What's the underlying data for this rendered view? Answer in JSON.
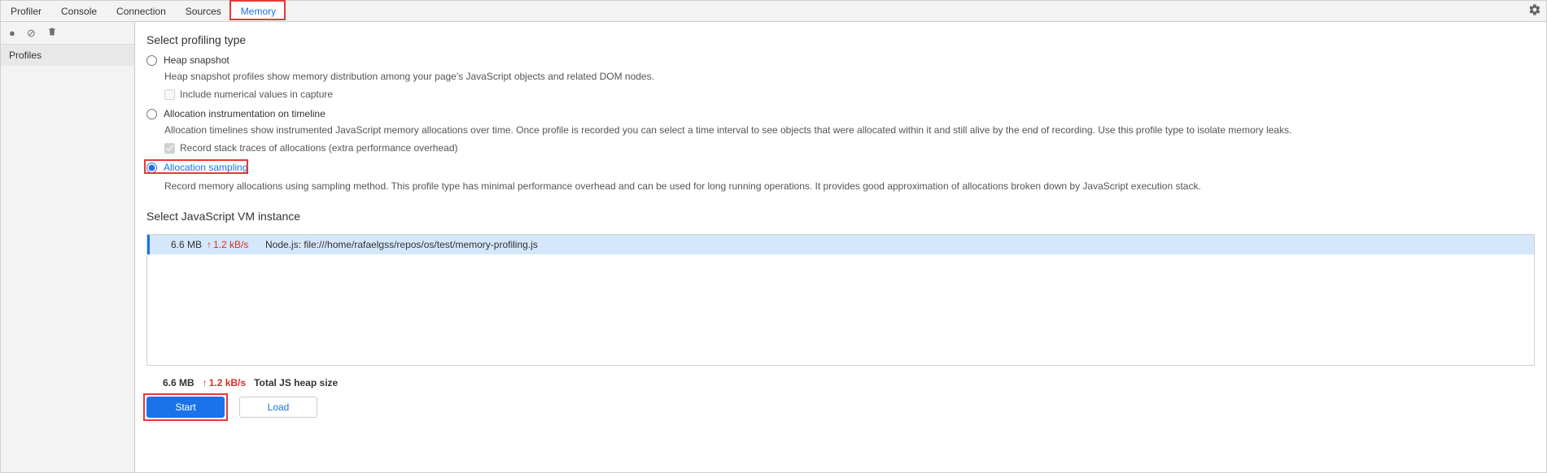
{
  "tabs": {
    "profiler": "Profiler",
    "console": "Console",
    "connection": "Connection",
    "sources": "Sources",
    "memory": "Memory"
  },
  "sidebar": {
    "profiles_label": "Profiles"
  },
  "main": {
    "select_type_title": "Select profiling type",
    "options": {
      "heap": {
        "label": "Heap snapshot",
        "desc": "Heap snapshot profiles show memory distribution among your page's JavaScript objects and related DOM nodes.",
        "sub": "Include numerical values in capture"
      },
      "timeline": {
        "label": "Allocation instrumentation on timeline",
        "desc": "Allocation timelines show instrumented JavaScript memory allocations over time. Once profile is recorded you can select a time interval to see objects that were allocated within it and still alive by the end of recording. Use this profile type to isolate memory leaks.",
        "sub": "Record stack traces of allocations (extra performance overhead)"
      },
      "sampling": {
        "label": "Allocation sampling",
        "desc": "Record memory allocations using sampling method. This profile type has minimal performance overhead and can be used for long running operations. It provides good approximation of allocations broken down by JavaScript execution stack."
      }
    },
    "vm_title": "Select JavaScript VM instance",
    "vm_row": {
      "size": "6.6 MB",
      "rate": "1.2 kB/s",
      "name": "Node.js: file:///home/rafaelgss/repos/os/test/memory-profiling.js"
    },
    "footer": {
      "size": "6.6 MB",
      "rate": "1.2 kB/s",
      "label": "Total JS heap size"
    },
    "buttons": {
      "start": "Start",
      "load": "Load"
    }
  }
}
